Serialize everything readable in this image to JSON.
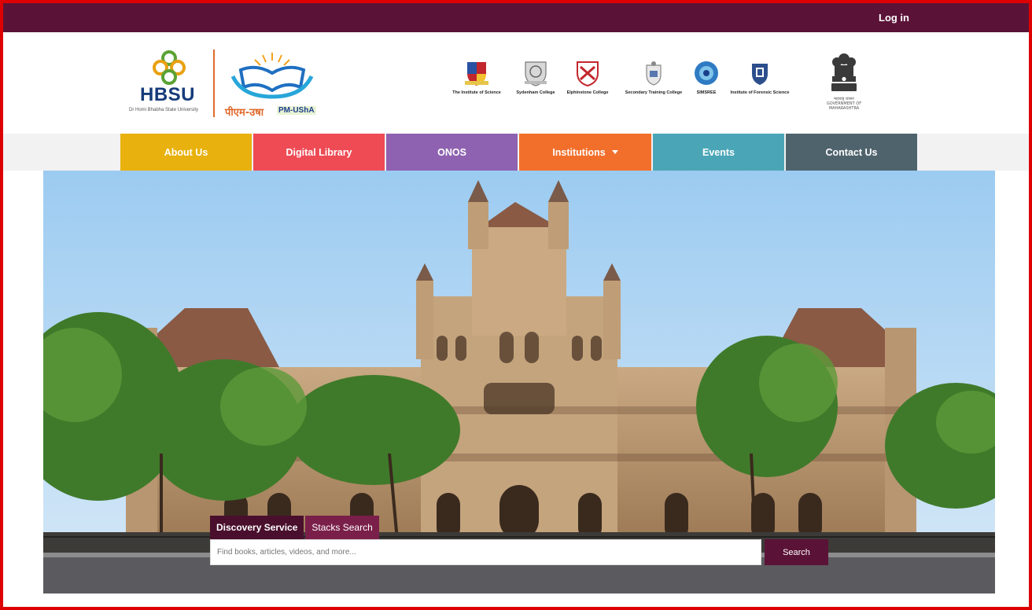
{
  "topbar": {
    "login_label": "Log in",
    "color": "#5b1237"
  },
  "logos": {
    "hbsu": {
      "name": "HBSU",
      "subtitle": "Dr Homi Bhabha State University"
    },
    "pm_usha": {
      "hindi": "पीएम-उषा",
      "english": "PM-UShA"
    },
    "colleges": [
      {
        "label": "The Institute of Science"
      },
      {
        "label": "Sydenham College"
      },
      {
        "label": "Elphinstone College"
      },
      {
        "label": "Secondary Training College"
      },
      {
        "label": "SIMSREE"
      },
      {
        "label": "Institute of Forensic Science"
      }
    ],
    "government": {
      "hindi": "महाराष्ट्र शासन",
      "line1": "GOVERNMENT OF",
      "line2": "MAHARASHTRA"
    }
  },
  "nav": {
    "items": [
      {
        "label": "About Us",
        "color": "#e8b10d"
      },
      {
        "label": "Digital Library",
        "color": "#ee4b55"
      },
      {
        "label": "ONOS",
        "color": "#8e62b0"
      },
      {
        "label": "Institutions",
        "color": "#f26f2b"
      },
      {
        "label": "Events",
        "color": "#4aa6b6"
      },
      {
        "label": "Contact Us",
        "color": "#4f636d"
      }
    ]
  },
  "search": {
    "tabs": [
      "Discovery Service",
      "Stacks Search"
    ],
    "placeholder": "Find books, articles, videos, and more...",
    "button_label": "Search"
  }
}
